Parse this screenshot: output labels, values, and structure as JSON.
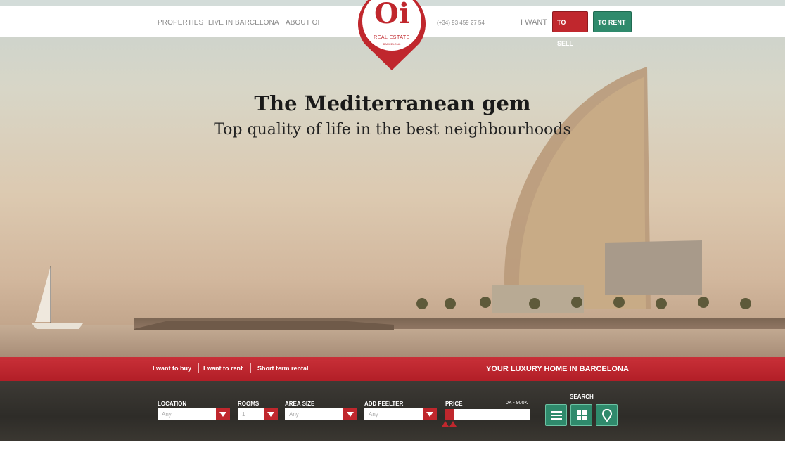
{
  "nav": {
    "links": [
      {
        "label": "PROPERTIES"
      },
      {
        "label": "LIVE IN BARCELONA"
      },
      {
        "label": "ABOUT OI"
      }
    ],
    "phone": "(+34) 93 459 27 54",
    "i_want_label": "I WANT",
    "to_sell_label": "TO SELL",
    "to_rent_label": "TO RENT"
  },
  "logo": {
    "mark": "Oi",
    "line1": "REAL ESTATE",
    "line2": "BARCELONA"
  },
  "hero": {
    "title": "The Mediterranean gem",
    "subtitle": "Top quality of life in the best neighbourhoods"
  },
  "tabs": {
    "items": [
      {
        "label": "I want to buy"
      },
      {
        "label": "I want to rent"
      },
      {
        "label": "Short term rental"
      }
    ],
    "tagline": "YOUR LUXURY HOME IN BARCELONA"
  },
  "search": {
    "filters": [
      {
        "label": "LOCATION",
        "value": "Any"
      },
      {
        "label": "ROOMS",
        "value": "1"
      },
      {
        "label": "AREA SIZE",
        "value": "Any"
      },
      {
        "label": "ADD FEELTER",
        "value": "Any"
      }
    ],
    "price_label": "PRICE",
    "price_range": "0K - 900K",
    "search_label": "SEARCH",
    "view_buttons": [
      "list-view-icon",
      "grid-view-icon",
      "map-pin-icon"
    ]
  },
  "colors": {
    "brand_red": "#c0272d",
    "brand_green": "#2f8a6c"
  }
}
